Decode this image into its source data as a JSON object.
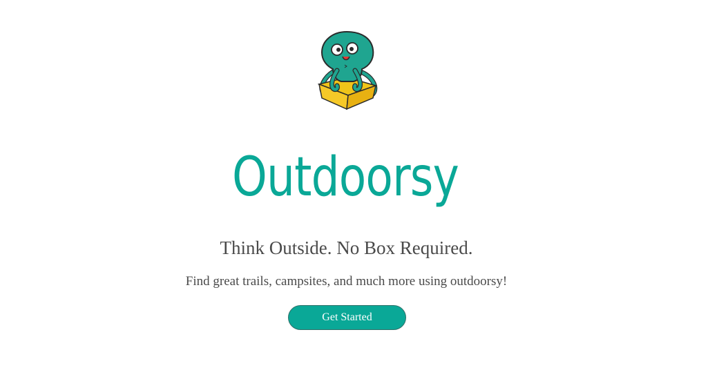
{
  "brand": {
    "wordmark": "Outdoorsy",
    "mascot_icon": "octopus-in-box-icon",
    "color": "#0aa897"
  },
  "hero": {
    "tagline": "Think Outside. No Box Required.",
    "subline": "Find great trails, campsites, and much more using outdoorsy!"
  },
  "cta": {
    "label": "Get Started",
    "color": "#0aa897",
    "text_color": "#ffffff"
  }
}
